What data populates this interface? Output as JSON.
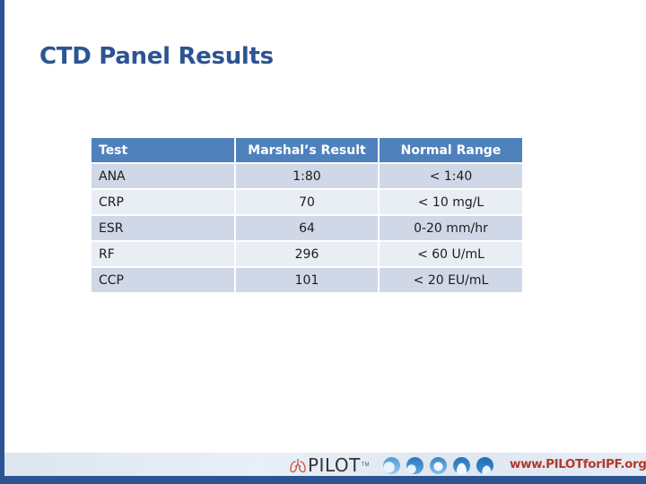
{
  "slide": {
    "title": "CTD Panel Results"
  },
  "table": {
    "headers": [
      "Test",
      "Marshal’s Result",
      "Normal Range"
    ],
    "rows": [
      [
        "ANA",
        "1:80",
        "< 1:40"
      ],
      [
        "CRP",
        "70",
        "< 10 mg/L"
      ],
      [
        "ESR",
        "64",
        "0-20 mm/hr"
      ],
      [
        "RF",
        "296",
        "< 60 U/mL"
      ],
      [
        "CCP",
        "101",
        "< 20 EU/mL"
      ]
    ]
  },
  "footer": {
    "logo_text": "PILOT",
    "trademark": "TM",
    "website": "www.PILOTforIPF.org",
    "icons": [
      "lungs-icon",
      "sky-icon",
      "sky-icon",
      "sky-icon",
      "sky-icon",
      "sky-icon"
    ]
  },
  "colors": {
    "brand_blue": "#2c5493",
    "header_blue": "#4f81bd",
    "row_odd": "#d0d8e8",
    "row_even": "#e9edf4",
    "website_red": "#b23a2c"
  }
}
